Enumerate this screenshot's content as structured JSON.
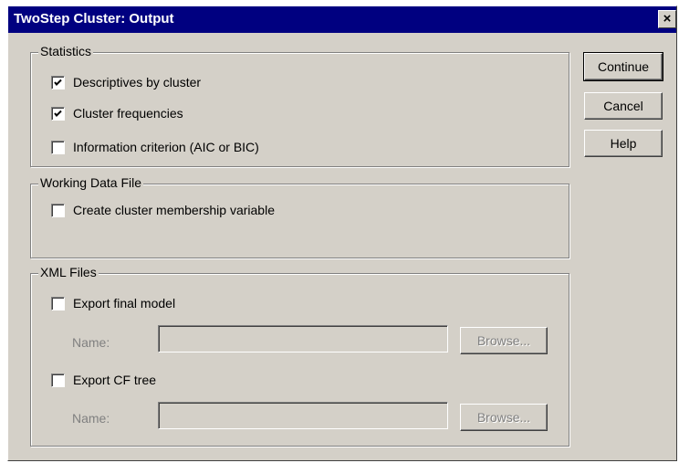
{
  "window": {
    "title": "TwoStep Cluster: Output",
    "close_glyph": "×"
  },
  "buttons": {
    "continue": "Continue",
    "cancel": "Cancel",
    "help": "Help"
  },
  "statistics": {
    "label": "Statistics",
    "items": [
      {
        "label": "Descriptives by cluster",
        "checked": true
      },
      {
        "label": "Cluster frequencies",
        "checked": true
      },
      {
        "label": "Information criterion (AIC or BIC)",
        "checked": false
      }
    ]
  },
  "working_data_file": {
    "label": "Working Data File",
    "items": [
      {
        "label": "Create cluster membership variable",
        "checked": false
      }
    ]
  },
  "xml_files": {
    "label": "XML Files",
    "final_model": {
      "label": "Export final model",
      "checked": false,
      "name_label": "Name:",
      "name_value": "",
      "browse": "Browse..."
    },
    "cf_tree": {
      "label": "Export CF tree",
      "checked": false,
      "name_label": "Name:",
      "name_value": "",
      "browse": "Browse..."
    }
  }
}
